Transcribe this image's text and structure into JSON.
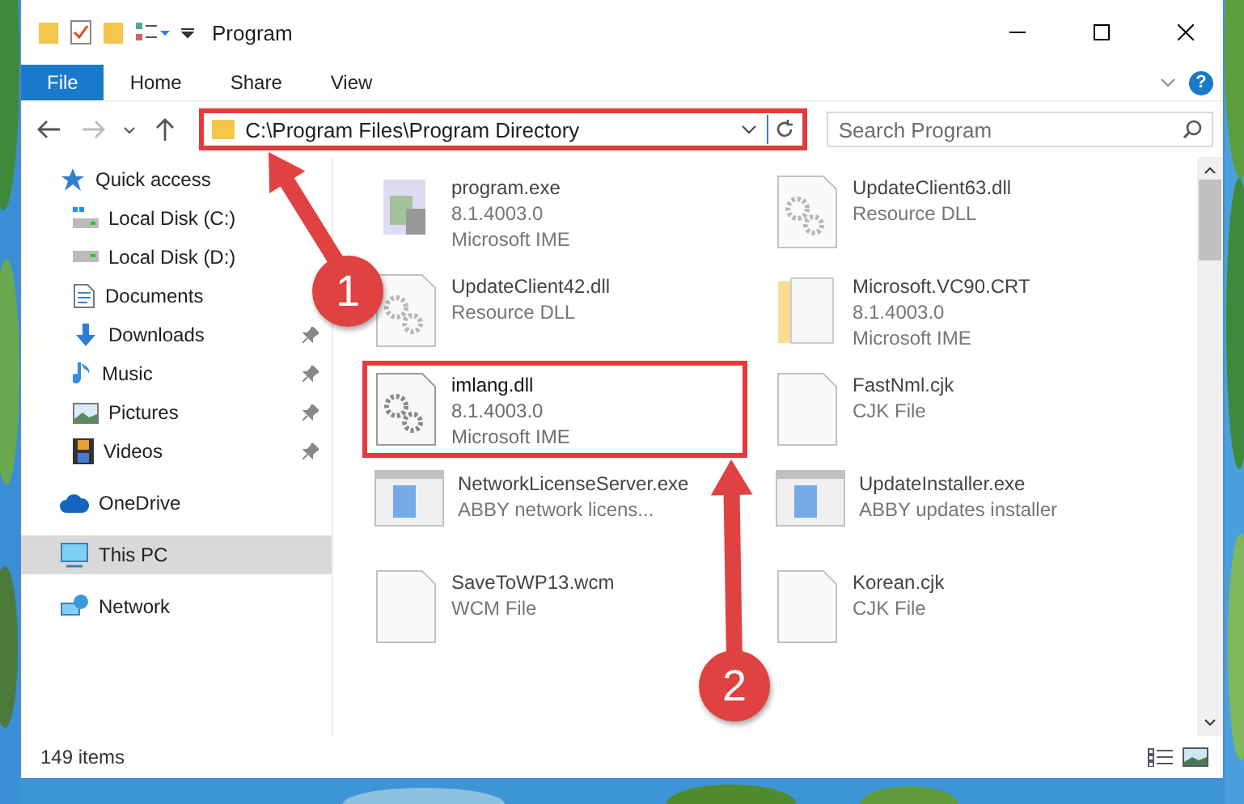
{
  "window": {
    "title": "Program"
  },
  "ribbon": {
    "tabs": [
      {
        "label": "File",
        "selected": true
      },
      {
        "label": "Home",
        "selected": false
      },
      {
        "label": "Share",
        "selected": false
      },
      {
        "label": "View",
        "selected": false
      }
    ],
    "help": "?"
  },
  "address": {
    "path": "C:\\Program Files\\Program Directory",
    "highlighted": true,
    "search_placeholder": "Search Program"
  },
  "sidebar": {
    "items": [
      {
        "label": "Quick access",
        "kind": "star",
        "selected": false,
        "children": [
          {
            "label": "Local Disk (C:)",
            "kind": "systemdisk",
            "pinned": false
          },
          {
            "label": "Local Disk (D:)",
            "kind": "disk",
            "pinned": false
          },
          {
            "label": "Documents",
            "kind": "document",
            "pinned": false
          },
          {
            "label": "Downloads",
            "kind": "download",
            "pinned": true
          },
          {
            "label": "Music",
            "kind": "music",
            "pinned": true
          },
          {
            "label": "Pictures",
            "kind": "pictures",
            "pinned": true
          },
          {
            "label": "Videos",
            "kind": "video",
            "pinned": true
          }
        ]
      },
      {
        "label": "OneDrive",
        "kind": "cloud",
        "selected": false
      },
      {
        "label": "This PC",
        "kind": "computer",
        "selected": true
      },
      {
        "label": "Network",
        "kind": "network",
        "selected": false
      }
    ]
  },
  "files": [
    {
      "name": "program.exe",
      "details": [
        "8.1.4003.0",
        "Microsoft IME"
      ],
      "kind": "app",
      "blurred": true,
      "highlighted": false
    },
    {
      "name": "UpdateClient63.dll",
      "details": [
        "Resource DLL"
      ],
      "kind": "gears",
      "blurred": true,
      "highlighted": false
    },
    {
      "name": "UpdateClient42.dll",
      "details": [
        "Resource DLL"
      ],
      "kind": "gears",
      "blurred": true,
      "highlighted": false
    },
    {
      "name": "Microsoft.VC90.CRT",
      "details": [
        "8.1.4003.0",
        "Microsoft IME"
      ],
      "kind": "folder",
      "blurred": true,
      "highlighted": false
    },
    {
      "name": "imlang.dll",
      "details": [
        "8.1.4003.0",
        "Microsoft IME"
      ],
      "kind": "gears",
      "blurred": false,
      "highlighted": true
    },
    {
      "name": "FastNml.cjk",
      "details": [
        "CJK File"
      ],
      "kind": "blank",
      "blurred": true,
      "highlighted": false
    },
    {
      "name": "NetworkLicenseServer.exe",
      "details": [
        "ABBY network licens..."
      ],
      "kind": "window",
      "blurred": true,
      "highlighted": false
    },
    {
      "name": "UpdateInstaller.exe",
      "details": [
        "ABBY updates installer"
      ],
      "kind": "window",
      "blurred": true,
      "highlighted": false
    },
    {
      "name": "SaveToWP13.wcm",
      "details": [
        "WCM File"
      ],
      "kind": "blank",
      "blurred": true,
      "highlighted": false
    },
    {
      "name": "Korean.cjk",
      "details": [
        "CJK File"
      ],
      "kind": "blank",
      "blurred": true,
      "highlighted": false
    }
  ],
  "status_bar": {
    "count": "149 items"
  },
  "callouts": [
    {
      "number": "1"
    },
    {
      "number": "2"
    }
  ]
}
